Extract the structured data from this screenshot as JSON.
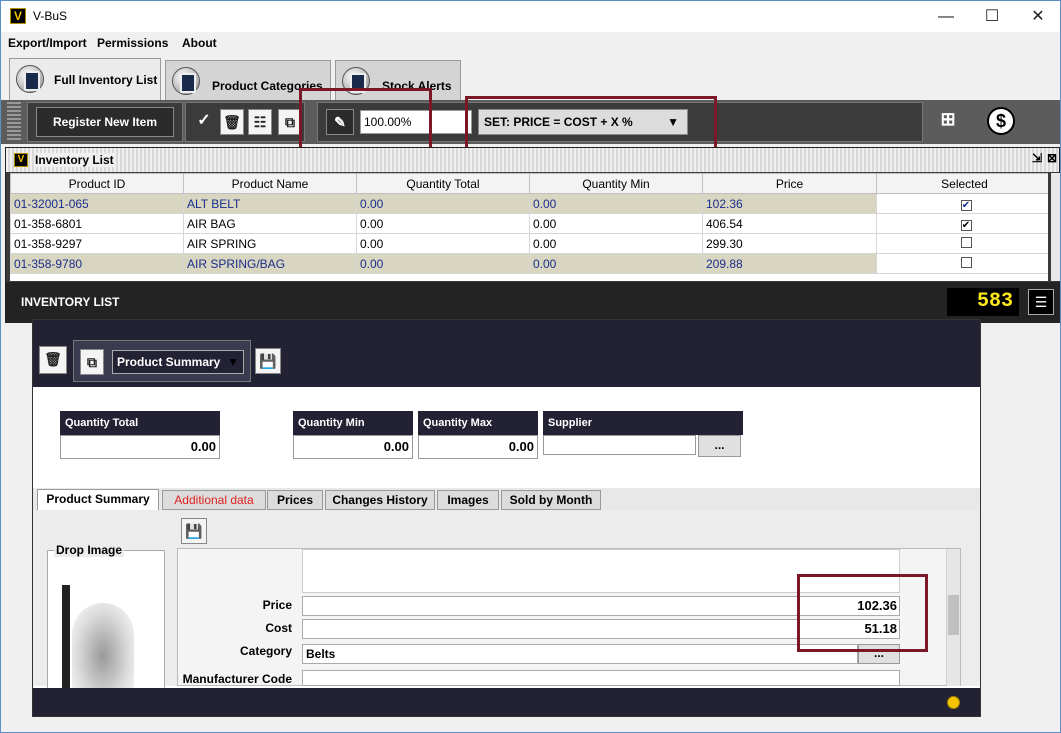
{
  "app": {
    "title": "V-BuS",
    "logo": "V"
  },
  "window_controls": {
    "minimize": "—",
    "maximize": "☐",
    "close": "✕"
  },
  "menu": [
    "Export/Import",
    "Permissions",
    "About"
  ],
  "main_tabs": [
    "Full Inventory List",
    "Product Categories",
    "Stock Alerts"
  ],
  "toolbar": {
    "register_label": "Register New Item",
    "percent_value": "100.00%",
    "set_mode": "SET: PRICE = COST + X %"
  },
  "inventory": {
    "title": "Inventory List",
    "columns": [
      "Product ID",
      "Product Name",
      "Quantity Total",
      "Quantity Min",
      "Price",
      "Selected"
    ],
    "rows": [
      {
        "id": "01-32001-065",
        "name": "ALT BELT",
        "qty_total": "0.00",
        "qty_min": "0.00",
        "price": "102.36",
        "selected": true,
        "highlight": true
      },
      {
        "id": "01-358-6801",
        "name": "AIR BAG",
        "qty_total": "0.00",
        "qty_min": "0.00",
        "price": "406.54",
        "selected": true,
        "highlight": false
      },
      {
        "id": "01-358-9297",
        "name": "AIR SPRING",
        "qty_total": "0.00",
        "qty_min": "0.00",
        "price": "299.30",
        "selected": false,
        "highlight": false
      },
      {
        "id": "01-358-9780",
        "name": "AIR SPRING/BAG",
        "qty_total": "0.00",
        "qty_min": "0.00",
        "price": "209.88",
        "selected": false,
        "highlight": true
      }
    ],
    "footer_label": "INVENTORY LIST",
    "count": "583"
  },
  "detail": {
    "view_select": "Product Summary",
    "fields": {
      "qty_total_label": "Quantity Total",
      "qty_total": "0.00",
      "qty_min_label": "Quantity Min",
      "qty_min": "0.00",
      "qty_max_label": "Quantity Max",
      "qty_max": "0.00",
      "supplier_label": "Supplier",
      "supplier": "",
      "browse": "..."
    },
    "sub_tabs": [
      "Product Summary",
      "Additional data",
      "Prices",
      "Changes History",
      "Images",
      "Sold by Month"
    ],
    "drop_image_label": "Drop Image",
    "price_label": "Price",
    "price": "102.36",
    "cost_label": "Cost",
    "cost": "51.18",
    "category_label": "Category",
    "category": "Belts",
    "category_browse": "...",
    "manufacturer_label": "Manufacturer Code",
    "manufacturer": ""
  },
  "colors": {
    "accent_dark": "#232235",
    "highlight_red": "#7a1828",
    "counter": "#ffe81a",
    "status_led": "#f5c400"
  }
}
